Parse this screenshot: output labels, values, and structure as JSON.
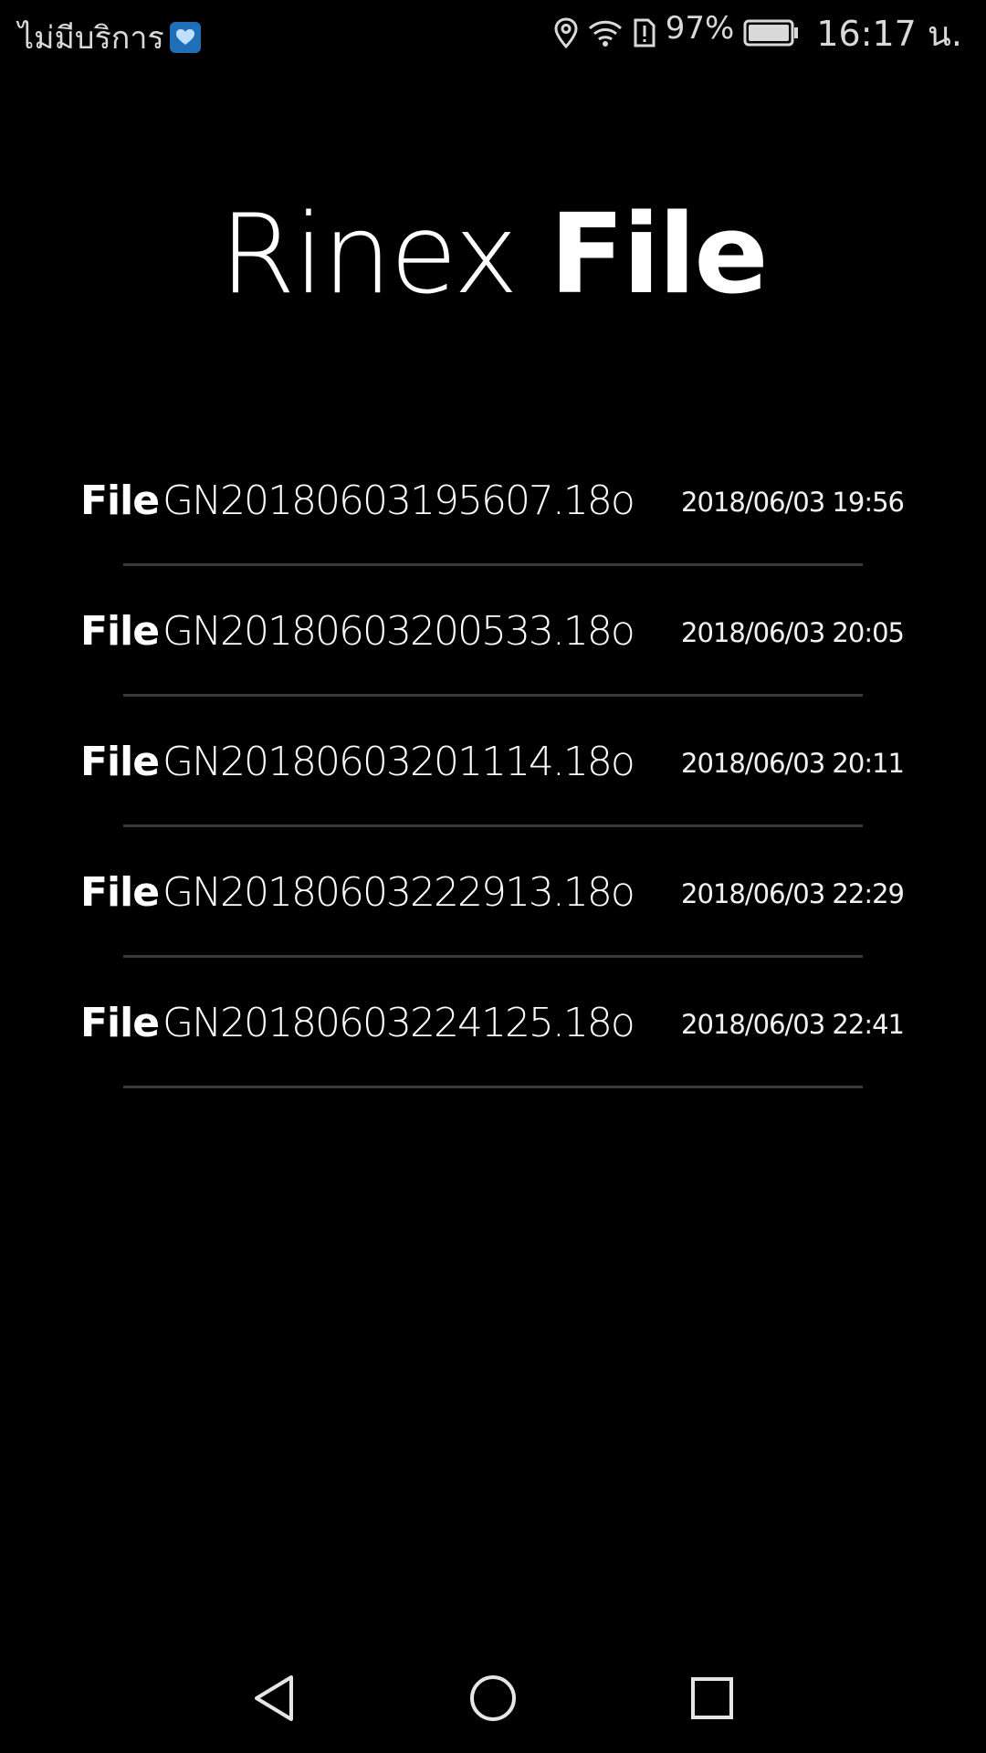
{
  "status_bar": {
    "carrier": "ไม่มีบริการ",
    "battery_percent": "97%",
    "time": "16:17 น."
  },
  "header": {
    "title_light": "Rinex",
    "title_bold": "File"
  },
  "files": [
    {
      "prefix": "File",
      "name": "GN20180603195607.18o",
      "date": "2018/06/03  19:56"
    },
    {
      "prefix": "File",
      "name": "GN20180603200533.18o",
      "date": "2018/06/03  20:05"
    },
    {
      "prefix": "File",
      "name": "GN20180603201114.18o",
      "date": "2018/06/03  20:11"
    },
    {
      "prefix": "File",
      "name": "GN20180603222913.18o",
      "date": "2018/06/03  22:29"
    },
    {
      "prefix": "File",
      "name": "GN20180603224125.18o",
      "date": "2018/06/03  22:41"
    }
  ],
  "nav_bar": {
    "icons": [
      "back-icon",
      "home-icon",
      "recents-icon"
    ]
  },
  "colors": {
    "background": "#000000",
    "text": "#ffffff",
    "divider": "#3a3a3a",
    "app_badge": "#1f6fb8"
  }
}
